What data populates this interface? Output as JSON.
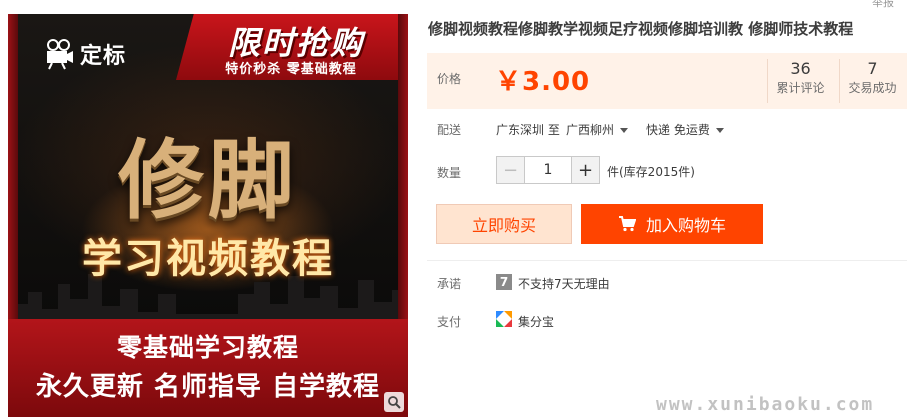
{
  "report_link": "举报",
  "image": {
    "logo_text": "定标",
    "promo_title": "限时抢购",
    "promo_subtitle": "特价秒杀 零基础教程",
    "main_title": "修脚",
    "sub_title": "学习视频教程",
    "bottom_line1": "零基础学习教程",
    "bottom_line2": "永久更新 名师指导 自学教程"
  },
  "product": {
    "title": "修脚视频教程修脚教学视频足疗视频修脚培训教 修脚师技术教程"
  },
  "price": {
    "label": "价格",
    "value": "￥3.00",
    "accent_color": "#ff4400",
    "reviews_count": "36",
    "reviews_label": "累计评论",
    "sales_count": "7",
    "sales_label": "交易成功"
  },
  "shipping": {
    "label": "配送",
    "from": "广东深圳 至",
    "to": "广西柳州",
    "method": "快递 免运费"
  },
  "quantity": {
    "label": "数量",
    "value": "1",
    "minus": "−",
    "plus": "+",
    "stock_text": "件(库存2015件)"
  },
  "actions": {
    "buy_now": "立即购买",
    "add_to_cart": "加入购物车"
  },
  "promise": {
    "label": "承诺",
    "icon_text": "7",
    "text": "不支持7天无理由"
  },
  "payment": {
    "label": "支付",
    "text": "集分宝"
  },
  "watermark": "www.xunibaoku.com"
}
